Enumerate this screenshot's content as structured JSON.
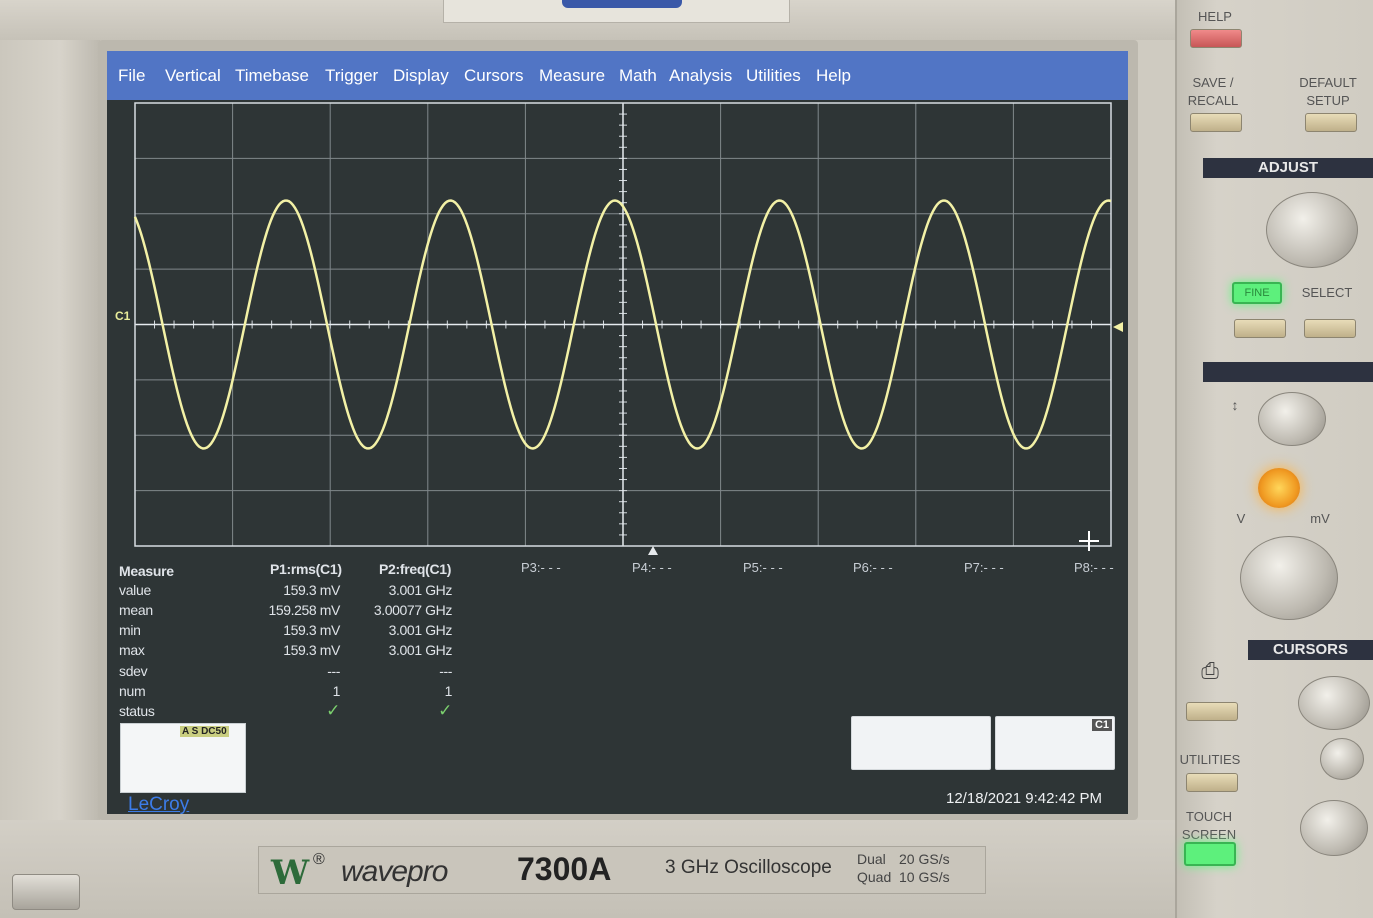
{
  "menu": [
    "File",
    "Vertical",
    "Timebase",
    "Trigger",
    "Display",
    "Cursors",
    "Measure",
    "Math",
    "Analysis",
    "Utilities",
    "Help"
  ],
  "channel_label": "C1",
  "param_slots": [
    "P3:- - -",
    "P4:- - -",
    "P5:- - -",
    "P6:- - -",
    "P7:- - -",
    "P8:- - -"
  ],
  "measure": {
    "header": "Measure",
    "p1_header": "P1:rms(C1)",
    "p2_header": "P2:freq(C1)",
    "rows": [
      {
        "label": "value",
        "p1": "159.3 mV",
        "p2": "3.001 GHz"
      },
      {
        "label": "mean",
        "p1": "159.258 mV",
        "p2": "3.00077 GHz"
      },
      {
        "label": "min",
        "p1": "159.3 mV",
        "p2": "3.001 GHz"
      },
      {
        "label": "max",
        "p1": "159.3 mV",
        "p2": "3.001 GHz"
      },
      {
        "label": "sdev",
        "p1": "---",
        "p2": "---"
      },
      {
        "label": "num",
        "p1": "1",
        "p2": "1"
      },
      {
        "label": "status",
        "p1": "✓",
        "p2": "✓"
      }
    ]
  },
  "c1_box_tag": "A S DC50",
  "trigger_box_tag": "C1",
  "brand": "LeCroy",
  "timestamp": "12/18/2021 9:42:42 PM",
  "panel": {
    "help": "HELP",
    "save_recall": "SAVE / RECALL",
    "default_setup": "DEFAULT SETUP",
    "adjust": "ADJUST",
    "fine": "FINE",
    "select": "SELECT",
    "volts": "V",
    "millivolts": "mV",
    "cursors": "CURSORS",
    "utilities": "UTILITIES",
    "touch_screen": "TOUCH SCREEN"
  },
  "nameplate": {
    "logo": "W",
    "reg": "®",
    "series": "wavepro",
    "model": "7300A",
    "description": "3 GHz Oscilloscope",
    "dual_label": "Dual",
    "dual_rate": "20 GS/s",
    "quad_label": "Quad",
    "quad_rate": "10 GS/s"
  },
  "waveform": {
    "channel": "C1",
    "shape": "sine",
    "cycles_visible": 6,
    "color": "#f3f1a6"
  }
}
